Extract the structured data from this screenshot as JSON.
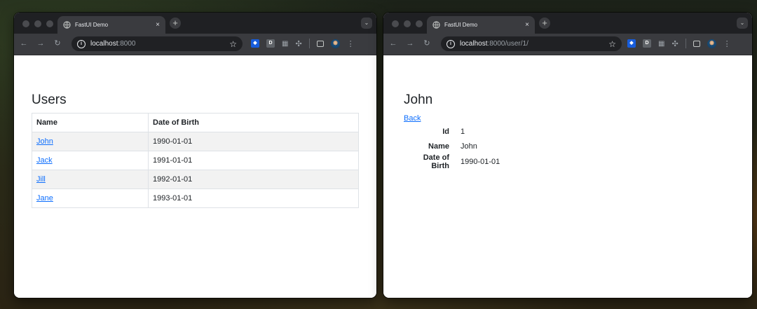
{
  "left_window": {
    "tab_title": "FastUI Demo",
    "url_host": "localhost",
    "url_path": ":8000",
    "page_title": "Users",
    "table": {
      "headers": [
        "Name",
        "Date of Birth"
      ],
      "rows": [
        {
          "name": "John",
          "dob": "1990-01-01"
        },
        {
          "name": "Jack",
          "dob": "1991-01-01"
        },
        {
          "name": "Jill",
          "dob": "1992-01-01"
        },
        {
          "name": "Jane",
          "dob": "1993-01-01"
        }
      ]
    }
  },
  "right_window": {
    "tab_title": "FastUI Demo",
    "url_host": "localhost",
    "url_path": ":8000/user/1/",
    "page_title": "John",
    "back_label": "Back",
    "details": [
      {
        "label": "Id",
        "value": "1"
      },
      {
        "label": "Name",
        "value": "John"
      },
      {
        "label": "Date of Birth",
        "value": "1990-01-01"
      }
    ]
  },
  "browser": {
    "tab_close_glyph": "×",
    "new_tab_glyph": "+",
    "colors": {
      "link": "#0d6efd",
      "chrome_dark": "#1f2023",
      "chrome_toolbar": "#3a3b3f"
    }
  }
}
